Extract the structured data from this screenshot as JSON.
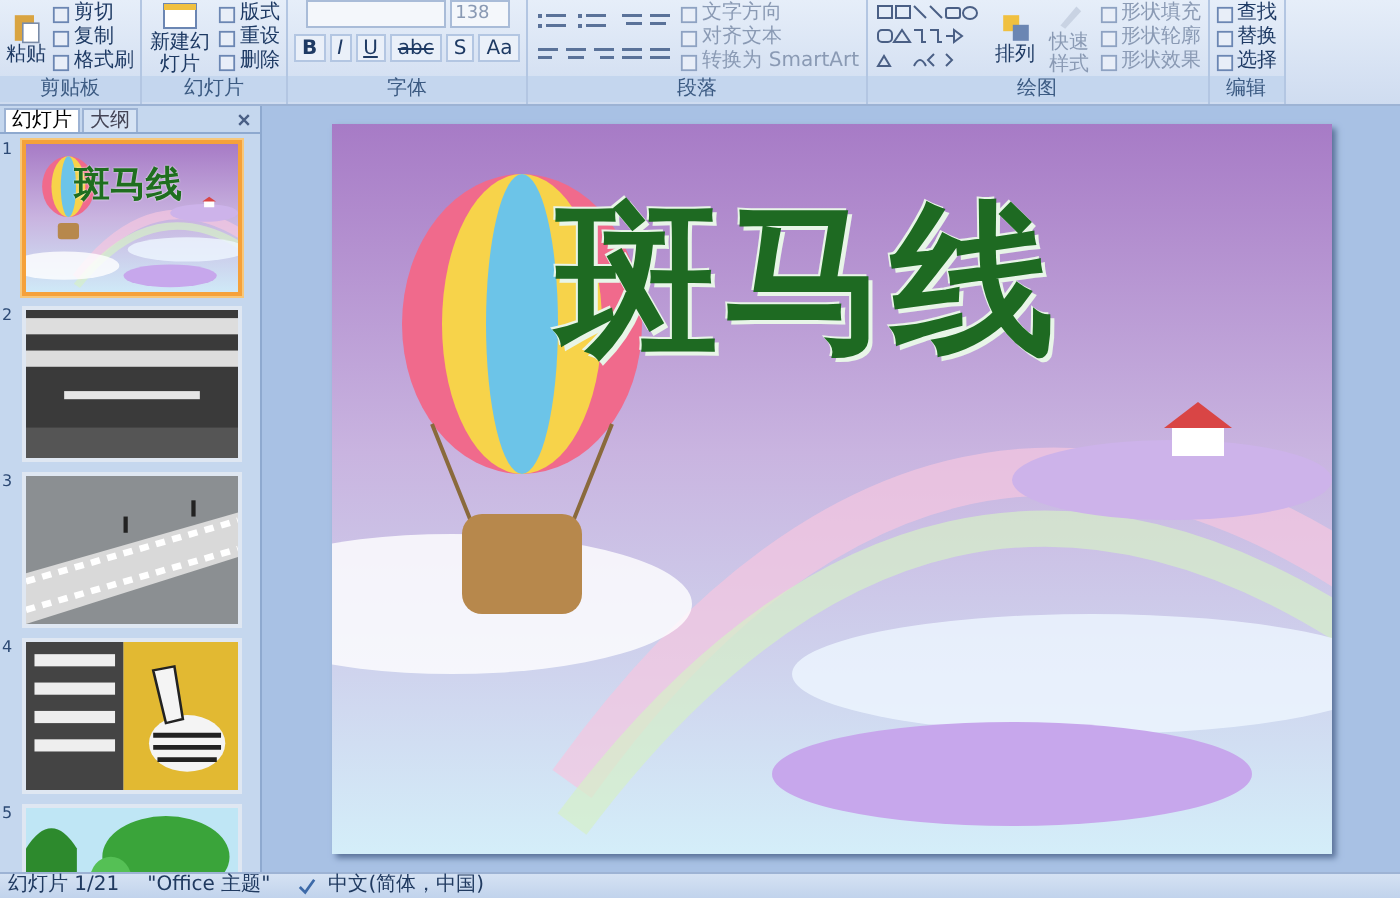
{
  "ribbon": {
    "clipboard": {
      "big": "粘贴",
      "items": [
        "剪切",
        "复制",
        "格式刷"
      ],
      "label": "剪贴板"
    },
    "slides": {
      "big": "新建幻灯片",
      "items": [
        "版式",
        "重设",
        "删除"
      ],
      "label": "幻灯片"
    },
    "font": {
      "size": "138",
      "buttons": [
        "B",
        "I",
        "U",
        "abc",
        "S",
        "Aa"
      ],
      "label": "字体"
    },
    "paragraph": {
      "items": [
        "文字方向",
        "对齐文本",
        "转换为 SmartArt"
      ],
      "label": "段落"
    },
    "drawing": {
      "big": [
        "排列",
        "快速样式"
      ],
      "items": [
        "形状填充",
        "形状轮廓",
        "形状效果"
      ],
      "label": "绘图"
    },
    "editing": {
      "items": [
        "查找",
        "替换",
        "选择"
      ],
      "label": "编辑"
    }
  },
  "pane": {
    "tabs": [
      {
        "label": "幻灯片",
        "selected": true
      },
      {
        "label": "大纲",
        "selected": false
      }
    ],
    "slides": [
      {
        "number": "1",
        "selected": true,
        "title": "斑马线"
      },
      {
        "number": "2",
        "selected": false
      },
      {
        "number": "3",
        "selected": false
      },
      {
        "number": "4",
        "selected": false
      },
      {
        "number": "5",
        "selected": false
      }
    ]
  },
  "slide": {
    "title": "斑马线"
  },
  "status_bar": {
    "slide": "幻灯片 1/21",
    "theme": "\"Office 主题\"",
    "language": "中文(简体，中国)"
  }
}
